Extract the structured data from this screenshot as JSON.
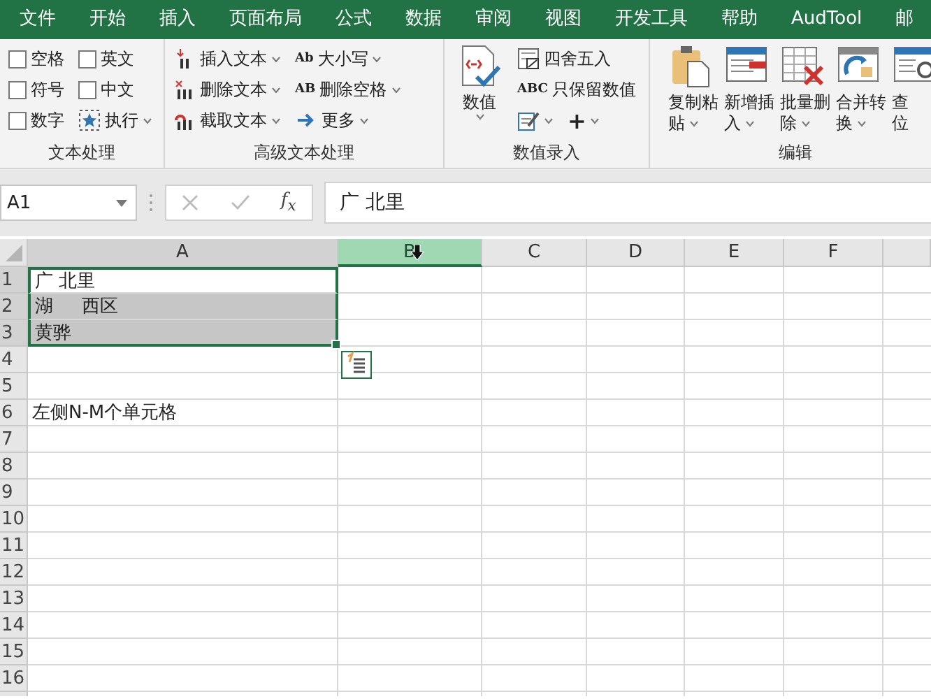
{
  "menu_tabs": [
    {
      "label": "文件",
      "selected": false
    },
    {
      "label": "开始",
      "selected": false
    },
    {
      "label": "插入",
      "selected": false
    },
    {
      "label": "页面布局",
      "selected": false
    },
    {
      "label": "公式",
      "selected": false
    },
    {
      "label": "数据",
      "selected": false
    },
    {
      "label": "审阅",
      "selected": false
    },
    {
      "label": "视图",
      "selected": false
    },
    {
      "label": "开发工具",
      "selected": false
    },
    {
      "label": "帮助",
      "selected": false
    },
    {
      "label": "AudTool",
      "selected": false
    },
    {
      "label": "邮",
      "selected": false
    }
  ],
  "ribbon": [
    {
      "label": "文本处理",
      "items": [
        {
          "kind": "checkbox",
          "label": "空格",
          "checked": false
        },
        {
          "kind": "checkbox",
          "label": "符号",
          "checked": false
        },
        {
          "kind": "checkbox",
          "label": "数字",
          "checked": false
        },
        {
          "kind": "checkbox",
          "label": "英文",
          "checked": false
        },
        {
          "kind": "checkbox",
          "label": "中文",
          "checked": false
        },
        {
          "kind": "small",
          "label": "执行",
          "dropdown": true
        }
      ]
    },
    {
      "label": "高级文本处理",
      "items": [
        {
          "kind": "small",
          "label": "插入文本",
          "dropdown": true
        },
        {
          "kind": "small",
          "label": "删除文本",
          "dropdown": true
        },
        {
          "kind": "small",
          "label": "截取文本",
          "dropdown": true
        },
        {
          "kind": "small",
          "badge": "Ab",
          "label": "大小写",
          "dropdown": true
        },
        {
          "kind": "small",
          "badge": "AB",
          "label": "删除空格",
          "dropdown": true
        },
        {
          "kind": "small",
          "label": "更多",
          "dropdown": true
        }
      ]
    },
    {
      "label": "数值录入",
      "items": [
        {
          "kind": "large",
          "lines": [
            "数值"
          ],
          "dropdown": true
        },
        {
          "kind": "small",
          "label": "四舍五入",
          "dropdown": false
        },
        {
          "kind": "small",
          "badge": "ABC",
          "label": "只保留数值",
          "dropdown": false
        },
        {
          "kind": "row",
          "items": [
            {
              "kind": "small",
              "dropdown": true
            },
            {
              "kind": "small",
              "label": "+",
              "dropdown": true
            }
          ]
        }
      ]
    },
    {
      "label": "编辑",
      "items": [
        {
          "kind": "large",
          "lines": [
            "复制粘",
            "贴"
          ],
          "dropdown": true
        },
        {
          "kind": "large",
          "lines": [
            "新增插",
            "入"
          ],
          "dropdown": true
        },
        {
          "kind": "large",
          "lines": [
            "批量删",
            "除"
          ],
          "dropdown": true
        },
        {
          "kind": "large",
          "lines": [
            "合并转",
            "换"
          ],
          "dropdown": true
        },
        {
          "kind": "large",
          "lines": [
            "查",
            "位"
          ],
          "dropdown": false
        }
      ]
    }
  ],
  "formula_bar": {
    "name_box": "A1",
    "function_label": "f$_{x}$",
    "formula": "广 北里"
  },
  "sheet": {
    "columns": [
      {
        "label": "A",
        "selected": false,
        "active": true
      },
      {
        "label": "B",
        "selected": true,
        "active": false
      },
      {
        "label": "C",
        "selected": false,
        "active": false
      },
      {
        "label": "D",
        "selected": false,
        "active": false
      },
      {
        "label": "E",
        "selected": false,
        "active": false
      },
      {
        "label": "F",
        "selected": false,
        "active": false
      }
    ],
    "rows": [
      {
        "number": "1",
        "cell_a": "广 北里",
        "shaded": false,
        "in_selection": true
      },
      {
        "number": "2",
        "cell_a": "湖     西区",
        "shaded": true,
        "in_selection": true
      },
      {
        "number": "3",
        "cell_a": "黄骅",
        "shaded": true,
        "in_selection": true
      },
      {
        "number": "4",
        "shaded": false,
        "in_selection": false
      },
      {
        "number": "5",
        "shaded": false,
        "in_selection": false
      },
      {
        "number": "6",
        "cell_a": "左侧N-M个单元格",
        "shaded": false,
        "in_selection": false
      },
      {
        "number": "7",
        "shaded": false,
        "in_selection": false
      },
      {
        "number": "8",
        "shaded": false,
        "in_selection": false
      },
      {
        "number": "9",
        "shaded": false,
        "in_selection": false
      },
      {
        "number": "10",
        "shaded": false,
        "in_selection": false
      },
      {
        "number": "11",
        "shaded": false,
        "in_selection": false
      },
      {
        "number": "12",
        "shaded": false,
        "in_selection": false
      },
      {
        "number": "13",
        "shaded": false,
        "in_selection": false
      },
      {
        "number": "14",
        "shaded": false,
        "in_selection": false
      },
      {
        "number": "15",
        "shaded": false,
        "in_selection": false
      },
      {
        "number": "16",
        "shaded": false,
        "in_selection": false
      }
    ]
  }
}
